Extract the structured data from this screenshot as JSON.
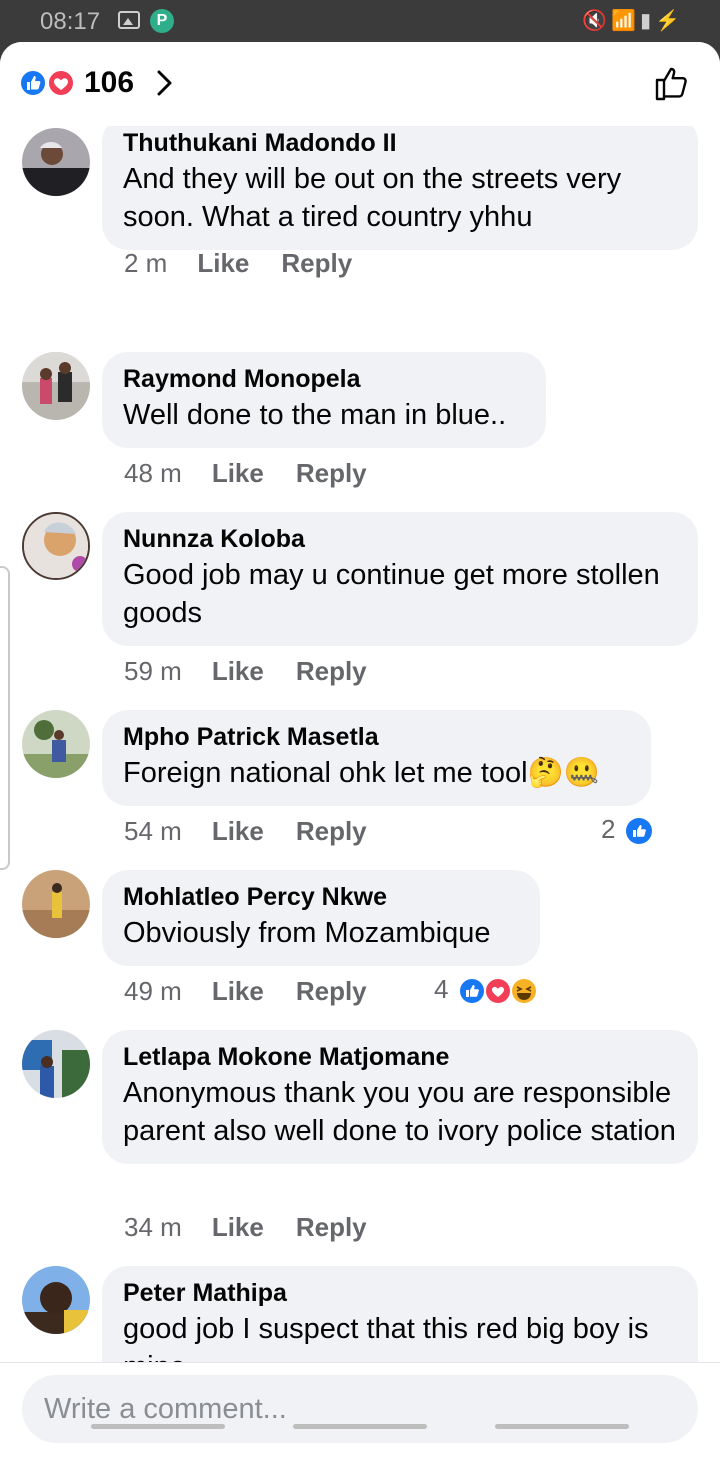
{
  "status_bar": {
    "time": "08:17",
    "icons": [
      "gallery-icon",
      "app-icon",
      "mute-icon",
      "wifi-icon",
      "signal-icon",
      "signal-icon",
      "battery-charging-icon"
    ]
  },
  "header": {
    "reaction_icons": [
      "like-icon",
      "love-icon"
    ],
    "reaction_count": "106"
  },
  "comments": [
    {
      "author": "Thuthukani Madondo II",
      "text": "And they will be out on the streets very soon. What a tired country yhhu",
      "time": "2 m",
      "like": "Like",
      "reply": "Reply"
    },
    {
      "author": "Raymond Monopela",
      "text": "Well done to the man in blue..",
      "time": "48 m",
      "like": "Like",
      "reply": "Reply"
    },
    {
      "author": "Nunnza Koloba",
      "text": "Good job may u continue get more stollen goods",
      "time": "59 m",
      "like": "Like",
      "reply": "Reply"
    },
    {
      "author": "Mpho Patrick Masetla",
      "text": "Foreign national ohk let me tool🤔🤐",
      "time": "54 m",
      "like": "Like",
      "reply": "Reply",
      "reactions": {
        "count": "2",
        "icons": [
          "like-icon"
        ]
      }
    },
    {
      "author": "Mohlatleo Percy Nkwe",
      "text": "Obviously from Mozambique",
      "time": "49 m",
      "like": "Like",
      "reply": "Reply",
      "reactions": {
        "count": "4",
        "icons": [
          "like-icon",
          "love-icon",
          "haha-icon"
        ]
      }
    },
    {
      "author": "Letlapa Mokone Matjomane",
      "text": "Anonymous thank you you are responsible parent also well done to ivory police station",
      "time": "34 m",
      "like": "Like",
      "reply": "Reply"
    },
    {
      "author": "Peter Mathipa",
      "text": "good job I suspect that this red big boy is mine"
    }
  ],
  "compose": {
    "placeholder": "Write a comment..."
  },
  "colors": {
    "like_blue": "#1877f2",
    "love_red": "#f33e58",
    "haha_yellow": "#f7b125",
    "bubble_bg": "#f0f2f5",
    "meta_gray": "#65676b"
  }
}
